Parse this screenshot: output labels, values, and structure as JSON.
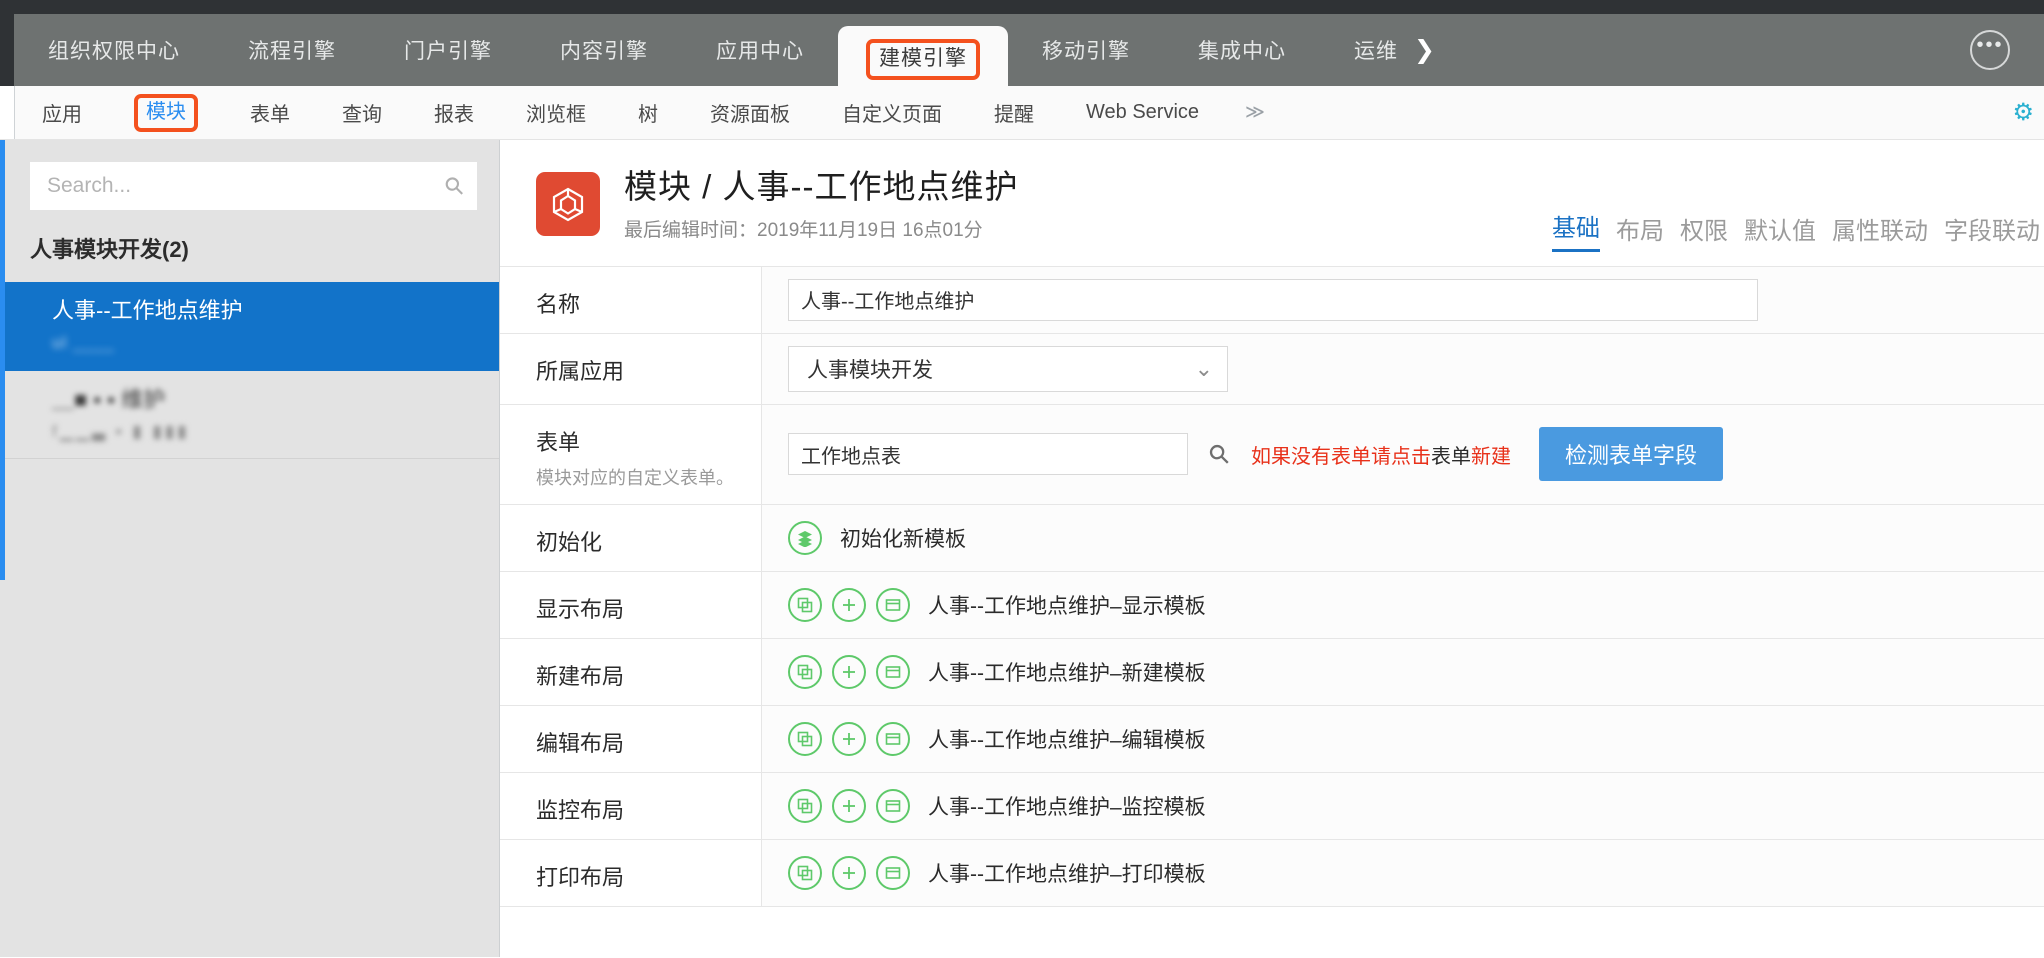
{
  "primary_nav": {
    "items": [
      {
        "label": "组织权限中心",
        "active": false
      },
      {
        "label": "流程引擎",
        "active": false
      },
      {
        "label": "门户引擎",
        "active": false
      },
      {
        "label": "内容引擎",
        "active": false
      },
      {
        "label": "应用中心",
        "active": false
      },
      {
        "label": "建模引擎",
        "active": true
      },
      {
        "label": "移动引擎",
        "active": false
      },
      {
        "label": "集成中心",
        "active": false
      },
      {
        "label": "运维",
        "active": false
      }
    ],
    "overflow_arrow": "❯",
    "ellipsis_label": "•••"
  },
  "secondary_nav": {
    "items": [
      {
        "label": "应用",
        "active": false
      },
      {
        "label": "模块",
        "active": true
      },
      {
        "label": "表单",
        "active": false
      },
      {
        "label": "查询",
        "active": false
      },
      {
        "label": "报表",
        "active": false
      },
      {
        "label": "浏览框",
        "active": false
      },
      {
        "label": "树",
        "active": false
      },
      {
        "label": "资源面板",
        "active": false
      },
      {
        "label": "自定义页面",
        "active": false
      },
      {
        "label": "提醒",
        "active": false
      },
      {
        "label": "Web Service",
        "active": false
      }
    ],
    "expand_label": "≫",
    "gear_label": "⚙"
  },
  "sidebar": {
    "search_placeholder": "Search...",
    "search_value": "",
    "search_icon": "⚲",
    "group_header": "人事模块开发(2)",
    "items": [
      {
        "title": "人事--工作地点维护",
        "sub": "ul  ____",
        "selected": true
      },
      {
        "title": "＿■ ▪ ▪ 维护",
        "sub": "f▁▁▃ ▪ ▮ ▮▮▮",
        "selected": false
      }
    ]
  },
  "main": {
    "title": "模块 / 人事--工作地点维护",
    "subtitle": "最后编辑时间：2019年11月19日 16点01分",
    "icon": "cube-icon",
    "icon_color": "#e04a32",
    "tabs": [
      {
        "label": "基础",
        "active": true
      },
      {
        "label": "布局",
        "active": false
      },
      {
        "label": "权限",
        "active": false
      },
      {
        "label": "默认值",
        "active": false
      },
      {
        "label": "属性联动",
        "active": false
      },
      {
        "label": "字段联动",
        "active": false
      }
    ],
    "rows": [
      {
        "type": "text",
        "label": "名称",
        "hint": "",
        "value": "人事--工作地点维护"
      },
      {
        "type": "select",
        "label": "所属应用",
        "hint": "",
        "value": "人事模块开发",
        "chevron": "⌄"
      },
      {
        "type": "form",
        "label": "表单",
        "hint": "模块对应的自定义表单。",
        "value": "工作地点表",
        "search_icon": "⚲",
        "note_prefix": "如果没有表单请点击",
        "note_mid": "表单",
        "note_suffix": "新建",
        "button_label": "检测表单字段"
      },
      {
        "type": "init",
        "label": "初始化",
        "hint": "",
        "icons": [
          "layers-icon"
        ],
        "template_name": "初始化新模板"
      },
      {
        "type": "layout",
        "label": "显示布局",
        "hint": "",
        "icons": [
          "copy-icon",
          "plus-icon",
          "window-icon"
        ],
        "template_name": "人事--工作地点维护–显示模板"
      },
      {
        "type": "layout",
        "label": "新建布局",
        "hint": "",
        "icons": [
          "copy-icon",
          "plus-icon",
          "window-icon"
        ],
        "template_name": "人事--工作地点维护–新建模板"
      },
      {
        "type": "layout",
        "label": "编辑布局",
        "hint": "",
        "icons": [
          "copy-icon",
          "plus-icon",
          "window-icon"
        ],
        "template_name": "人事--工作地点维护–编辑模板"
      },
      {
        "type": "layout",
        "label": "监控布局",
        "hint": "",
        "icons": [
          "copy-icon",
          "plus-icon",
          "window-icon"
        ],
        "template_name": "人事--工作地点维护–监控模板"
      },
      {
        "type": "layout",
        "label": "打印布局",
        "hint": "",
        "icons": [
          "copy-icon",
          "plus-icon",
          "window-icon"
        ],
        "template_name": "人事--工作地点维护–打印模板"
      }
    ]
  },
  "colors": {
    "accent_blue": "#2a8df0",
    "highlight_red": "#f4511e",
    "selected_blue": "#1273c9",
    "green": "#5ec96a",
    "cube_red": "#e04a32",
    "note_red": "#e8311a",
    "button_blue": "#4a9ae0"
  }
}
